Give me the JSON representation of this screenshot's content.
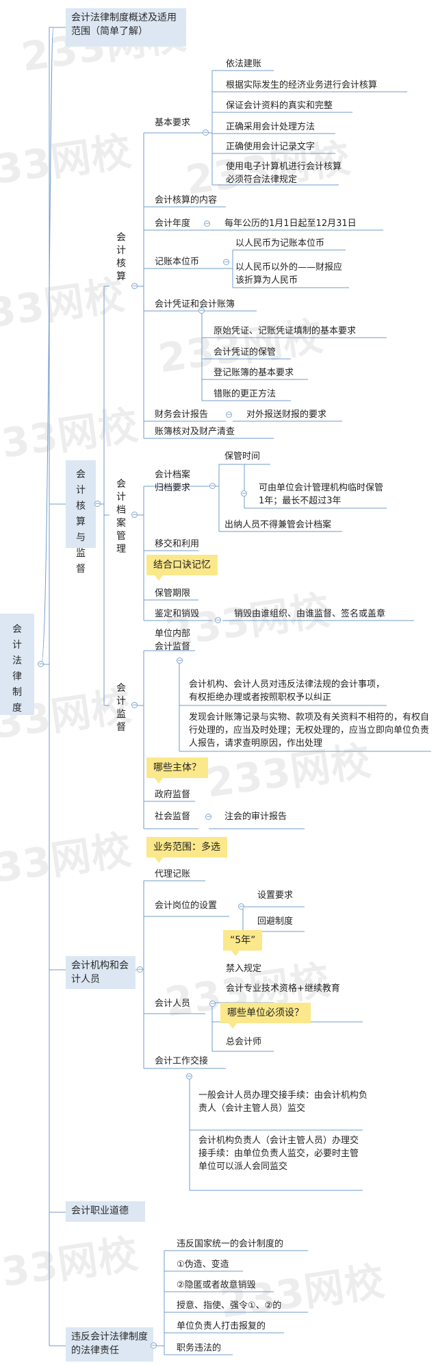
{
  "watermark": "233网校",
  "root": "会计法律制度",
  "branches": {
    "overview": "会计法律制度概述及适用范围（简单了解）",
    "accounting": "会计核算与监督",
    "org": "会计机构和会计人员",
    "ethics": "会计职业道德",
    "liability": "违反会计法律制度的法律责任"
  },
  "hesuan": {
    "title": "会计核算",
    "basic": "基本要求",
    "basic_items": [
      "依法建账",
      "根据实际发生的经济业务进行会计核算",
      "保证会计资料的真实和完整",
      "正确采用会计处理方法",
      "正确使用会计记录文字",
      "使用电子计算机进行会计核算必须符合法律规定"
    ],
    "content": "会计核算的内容",
    "year": "会计年度",
    "year_val": "每年公历的1月1日起至12月31日",
    "currency": "记账本位币",
    "currency_items": [
      "以人民币为记账本位币",
      "以人民币以外的——财报应该折算为人民币"
    ],
    "voucher": "会计凭证和会计账簿",
    "voucher_items": [
      "原始凭证、记账凭证填制的基本要求",
      "会计凭证的保管",
      "登记账簿的基本要求",
      "错账的更正方法"
    ],
    "report": "财务会计报告",
    "report_val": "对外报送财报的要求",
    "check": "账簿核对及财产清查"
  },
  "archive": {
    "title": "会计档案管理",
    "req": "会计档案归档要求",
    "keep_time": "保管时间",
    "keep_detail": "可由单位会计管理机构临时保管1年；最长不超过3年",
    "cashier": "出纳人员不得兼管会计档案",
    "transfer": "移交和利用",
    "note": "结合口诀记忆",
    "period": "保管期限",
    "destroy": "鉴定和销毁",
    "destroy_val": "销毁由谁组织、由谁监督、签名或盖章"
  },
  "supervision": {
    "title": "会计监督",
    "internal": "单位内部会计监督",
    "internal_items": [
      "会计机构、会计人员对违反法律法规的会计事项，有权拒绝办理或者按照职权予以纠正",
      "发现会计账簿记录与实物、款项及有关资料不相符的，有权自行处理的，应当及时处理；无权处理的，应当立即向单位负责人报告，请求查明原因，作出处理"
    ],
    "note": "哪些主体？",
    "gov": "政府监督",
    "social": "社会监督",
    "social_val": "注会的审计报告"
  },
  "org": {
    "note": "业务范围：多选",
    "agent": "代理记账",
    "post": "会计岗位的设置",
    "post_items": [
      "设置要求",
      "回避制度"
    ],
    "staff": "会计人员",
    "staff_note": "“5年”",
    "staff_items": [
      "禁入规定",
      "会计专业技术资格+继续教育",
      "总会计师"
    ],
    "staff_note2": "哪些单位必须设？",
    "handover": "会计工作交接",
    "handover_items": [
      "一般会计人员办理交接手续：由会计机构负责人（会计主管人员）监交",
      "会计机构负责人（会计主管人员）办理交接手续：由单位负责人监交，必要时主管单位可以派人会同监交"
    ]
  },
  "liability_items": [
    "违反国家统一的会计制度的",
    "①伪造、变造",
    "②隐匿或者故意销毁",
    "授意、指使、强令①、②的",
    "单位负责人打击报复的",
    "职务违法的"
  ]
}
